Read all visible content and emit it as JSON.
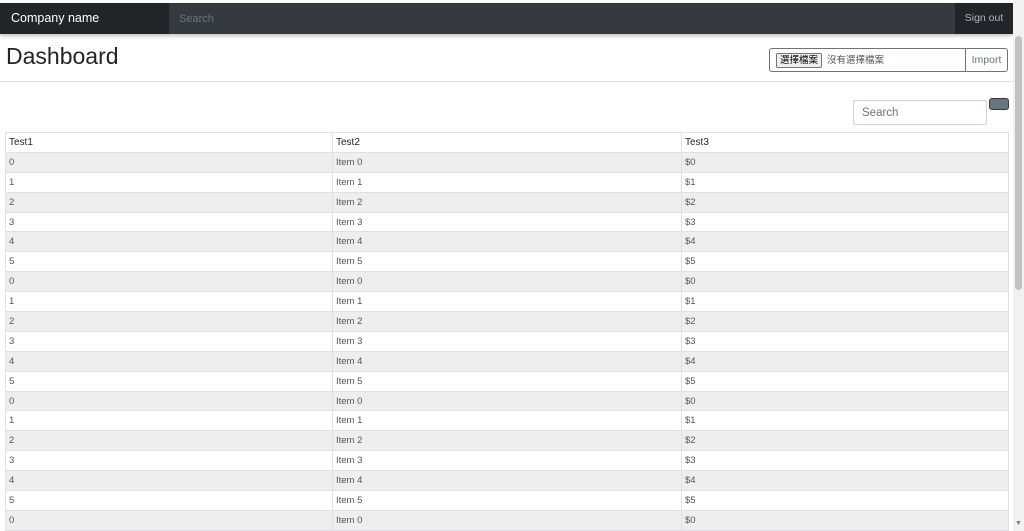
{
  "navbar": {
    "brand": "Company name",
    "search_placeholder": "Search",
    "signout_label": "Sign out"
  },
  "page": {
    "title": "Dashboard"
  },
  "file_input": {
    "button_label": "選擇檔案",
    "status_text": "沒有選擇檔案"
  },
  "import_label": "Import",
  "table_search": {
    "placeholder": "Search"
  },
  "table": {
    "columns": [
      "Test1",
      "Test2",
      "Test3"
    ],
    "rows": [
      [
        "0",
        "Item 0",
        "$0"
      ],
      [
        "1",
        "Item 1",
        "$1"
      ],
      [
        "2",
        "Item 2",
        "$2"
      ],
      [
        "3",
        "Item 3",
        "$3"
      ],
      [
        "4",
        "Item 4",
        "$4"
      ],
      [
        "5",
        "Item 5",
        "$5"
      ],
      [
        "0",
        "Item 0",
        "$0"
      ],
      [
        "1",
        "Item 1",
        "$1"
      ],
      [
        "2",
        "Item 2",
        "$2"
      ],
      [
        "3",
        "Item 3",
        "$3"
      ],
      [
        "4",
        "Item 4",
        "$4"
      ],
      [
        "5",
        "Item 5",
        "$5"
      ],
      [
        "0",
        "Item 0",
        "$0"
      ],
      [
        "1",
        "Item 1",
        "$1"
      ],
      [
        "2",
        "Item 2",
        "$2"
      ],
      [
        "3",
        "Item 3",
        "$3"
      ],
      [
        "4",
        "Item 4",
        "$4"
      ],
      [
        "5",
        "Item 5",
        "$5"
      ],
      [
        "0",
        "Item 0",
        "$0"
      ]
    ]
  },
  "colors": {
    "navbar_bg": "#343a40",
    "brand_bg": "#212529",
    "stripe": "#eeeeee",
    "border": "#dee2e6"
  },
  "icons": {
    "scroll_down": "chevron-down-icon"
  }
}
